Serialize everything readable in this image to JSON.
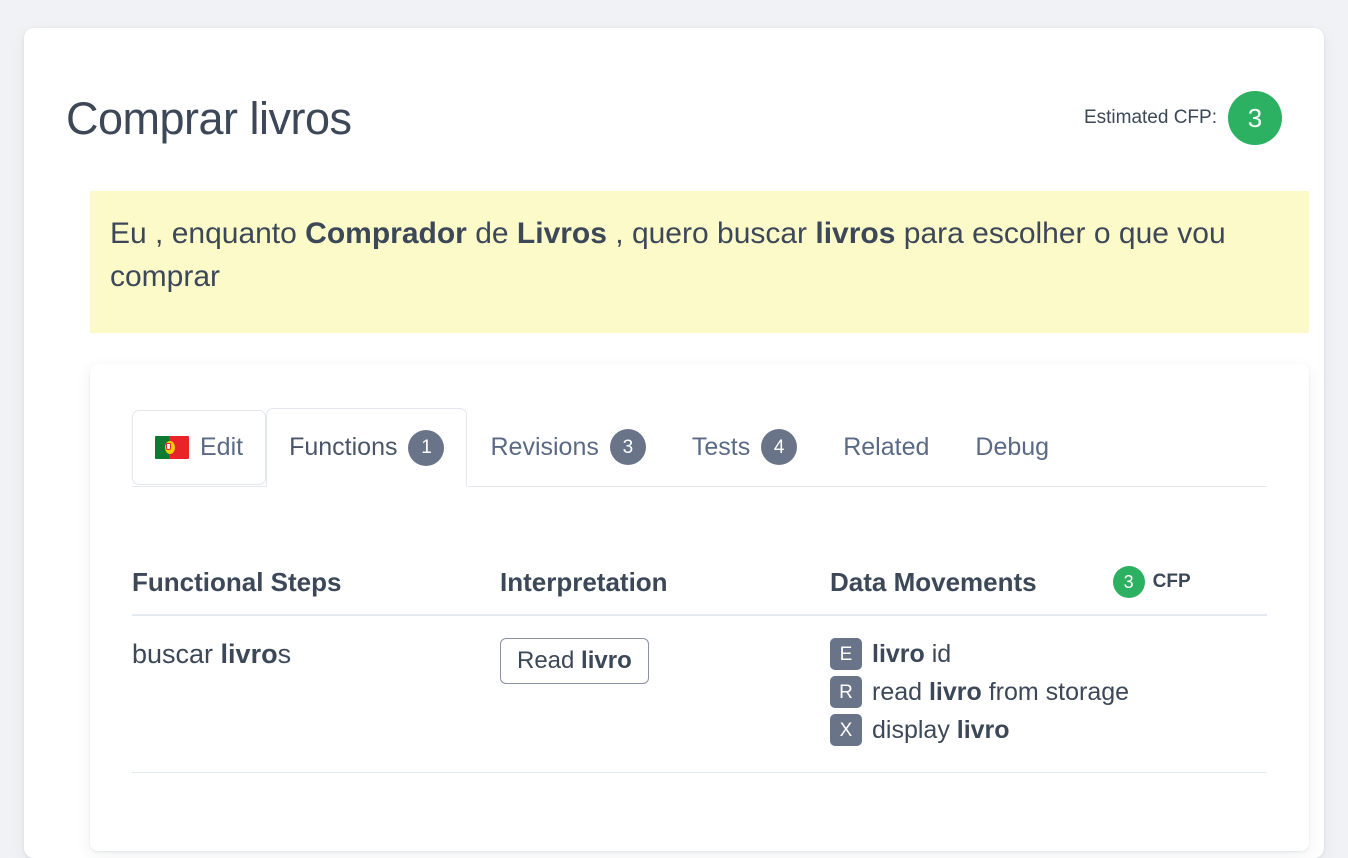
{
  "page": {
    "title": "Comprar livros"
  },
  "estimate": {
    "label": "Estimated CFP:",
    "value": "3",
    "color": "#2bb161"
  },
  "story": {
    "parts": [
      {
        "text": "Eu , enquanto ",
        "bold": false
      },
      {
        "text": "Comprador",
        "bold": true
      },
      {
        "text": " de ",
        "bold": false
      },
      {
        "text": "Livros",
        "bold": true
      },
      {
        "text": " , quero buscar ",
        "bold": false
      },
      {
        "text": "livros",
        "bold": true
      },
      {
        "text": " para escolher o que vou comprar",
        "bold": false
      }
    ],
    "background": "#fcfac9"
  },
  "tabs": [
    {
      "label": "Edit",
      "badge": null,
      "active": false,
      "icon": "flag-pt-icon",
      "style": "bordered"
    },
    {
      "label": "Functions",
      "badge": "1",
      "active": true,
      "icon": null,
      "style": "active"
    },
    {
      "label": "Revisions",
      "badge": "3",
      "active": false,
      "icon": null,
      "style": "plain"
    },
    {
      "label": "Tests",
      "badge": "4",
      "active": false,
      "icon": null,
      "style": "plain"
    },
    {
      "label": "Related",
      "badge": null,
      "active": false,
      "icon": null,
      "style": "plain"
    },
    {
      "label": "Debug",
      "badge": null,
      "active": false,
      "icon": null,
      "style": "plain"
    }
  ],
  "table": {
    "headers": {
      "steps": "Functional Steps",
      "interpretation": "Interpretation",
      "data_movements": "Data Movements"
    },
    "cfp": {
      "value": "3",
      "label": "CFP",
      "color": "#2bb161"
    },
    "rows": [
      {
        "step_parts": [
          {
            "text": "buscar ",
            "bold": false
          },
          {
            "text": "livro",
            "bold": true
          },
          {
            "text": "s",
            "bold": false
          }
        ],
        "interpretation_parts": [
          {
            "text": "Read ",
            "bold": false
          },
          {
            "text": "livro",
            "bold": true
          }
        ],
        "movements": [
          {
            "type": "E",
            "parts": [
              {
                "text": "livro",
                "bold": true
              },
              {
                "text": " id",
                "bold": false
              }
            ]
          },
          {
            "type": "R",
            "parts": [
              {
                "text": "read ",
                "bold": false
              },
              {
                "text": "livro",
                "bold": true
              },
              {
                "text": " from storage",
                "bold": false
              }
            ]
          },
          {
            "type": "X",
            "parts": [
              {
                "text": "display ",
                "bold": false
              },
              {
                "text": "livro",
                "bold": true
              }
            ]
          }
        ]
      }
    ]
  }
}
